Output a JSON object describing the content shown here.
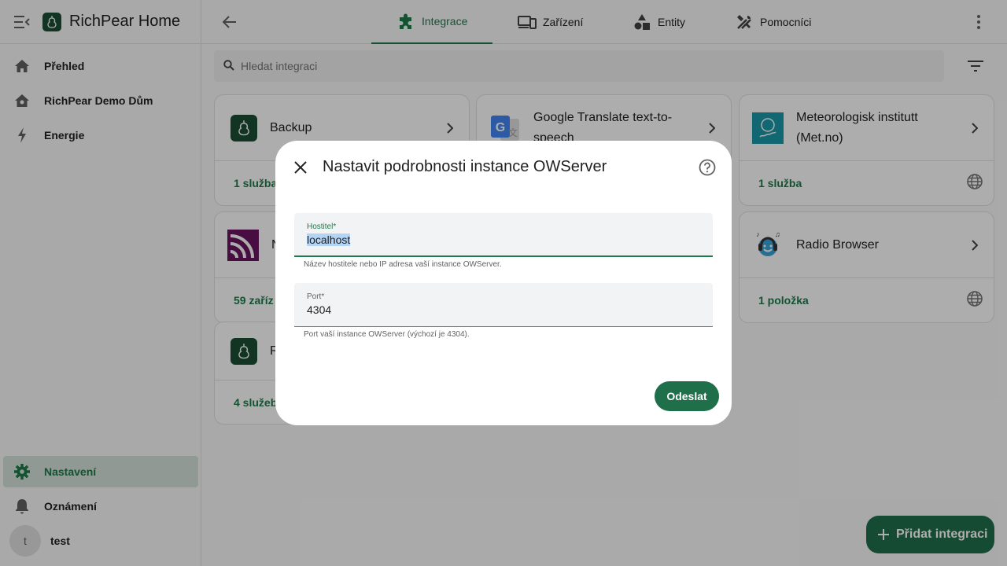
{
  "app": {
    "title": "RichPear Home"
  },
  "sidebar": {
    "items": [
      {
        "label": "Přehled",
        "icon": "home-icon"
      },
      {
        "label": "RichPear Demo Dům",
        "icon": "home-outline-icon"
      },
      {
        "label": "Energie",
        "icon": "lightning-icon"
      }
    ],
    "bottom": [
      {
        "label": "Nastavení",
        "icon": "gear-icon",
        "active": true
      },
      {
        "label": "Oznámení",
        "icon": "bell-icon"
      }
    ],
    "user": {
      "initial": "t",
      "name": "test"
    }
  },
  "tabs": [
    {
      "label": "Integrace",
      "icon": "puzzle-icon",
      "active": true
    },
    {
      "label": "Zařízení",
      "icon": "devices-icon"
    },
    {
      "label": "Entity",
      "icon": "shapes-icon"
    },
    {
      "label": "Pomocníci",
      "icon": "tools-icon"
    }
  ],
  "search": {
    "placeholder": "Hledat integraci"
  },
  "cards": [
    {
      "name": "Backup",
      "count": "1 služba",
      "logo": "pear-logo"
    },
    {
      "name": "Google Translate text-to-speech",
      "count": "",
      "logo": "google-translate-logo"
    },
    {
      "name": "Meteorologisk institutt (Met.no)",
      "count": "1 služba",
      "logo": "metno-logo"
    },
    {
      "name": "N",
      "count": "59 zaříz",
      "logo": "rss-logo"
    },
    {
      "name": "Radio Browser",
      "count": "1 položka",
      "logo": "radio-browser-logo"
    },
    {
      "name": "R",
      "count": "4 služeb",
      "logo": "pear-logo"
    }
  ],
  "fab": {
    "label": "Přidat integraci"
  },
  "dialog": {
    "title": "Nastavit podrobnosti instance OWServer",
    "fields": [
      {
        "label": "Hostitel*",
        "value": "localhost",
        "helper": "Název hostitele nebo IP adresa vaší instance OWServer."
      },
      {
        "label": "Port*",
        "value": "4304",
        "helper": "Port vaší instance OWServer (výchozí je 4304)."
      }
    ],
    "submit": "Odeslat"
  },
  "colors": {
    "accent": "#1e7a4b",
    "fab": "#1f6f4a",
    "metno": "#1a9aa8",
    "rss": "#6b1460"
  }
}
